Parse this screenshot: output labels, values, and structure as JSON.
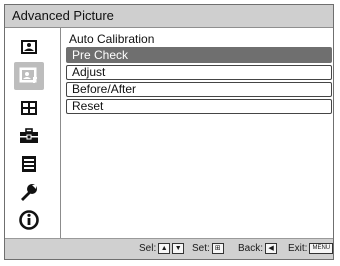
{
  "window": {
    "title": "Advanced Picture"
  },
  "sidebar": {
    "items": [
      {
        "name": "picture-icon"
      },
      {
        "name": "advanced-picture-icon",
        "selected": true
      },
      {
        "name": "screen-icon"
      },
      {
        "name": "setup-icon"
      },
      {
        "name": "menu-icon"
      },
      {
        "name": "installation-icon"
      },
      {
        "name": "information-icon"
      }
    ]
  },
  "main": {
    "section_title": "Auto Calibration",
    "items": [
      {
        "label": "Pre Check",
        "selected": true
      },
      {
        "label": "Adjust"
      },
      {
        "label": "Before/After"
      },
      {
        "label": "Reset"
      }
    ]
  },
  "footer": {
    "sel_label": "Sel:",
    "set_label": "Set:",
    "back_label": "Back:",
    "exit_label": "Exit:",
    "menu_key": "MENU"
  },
  "colors": {
    "bar_gray": "#d0d0d0",
    "selected_gray": "#6f6f6f",
    "icon_selected_bg": "#bdbdbd"
  }
}
